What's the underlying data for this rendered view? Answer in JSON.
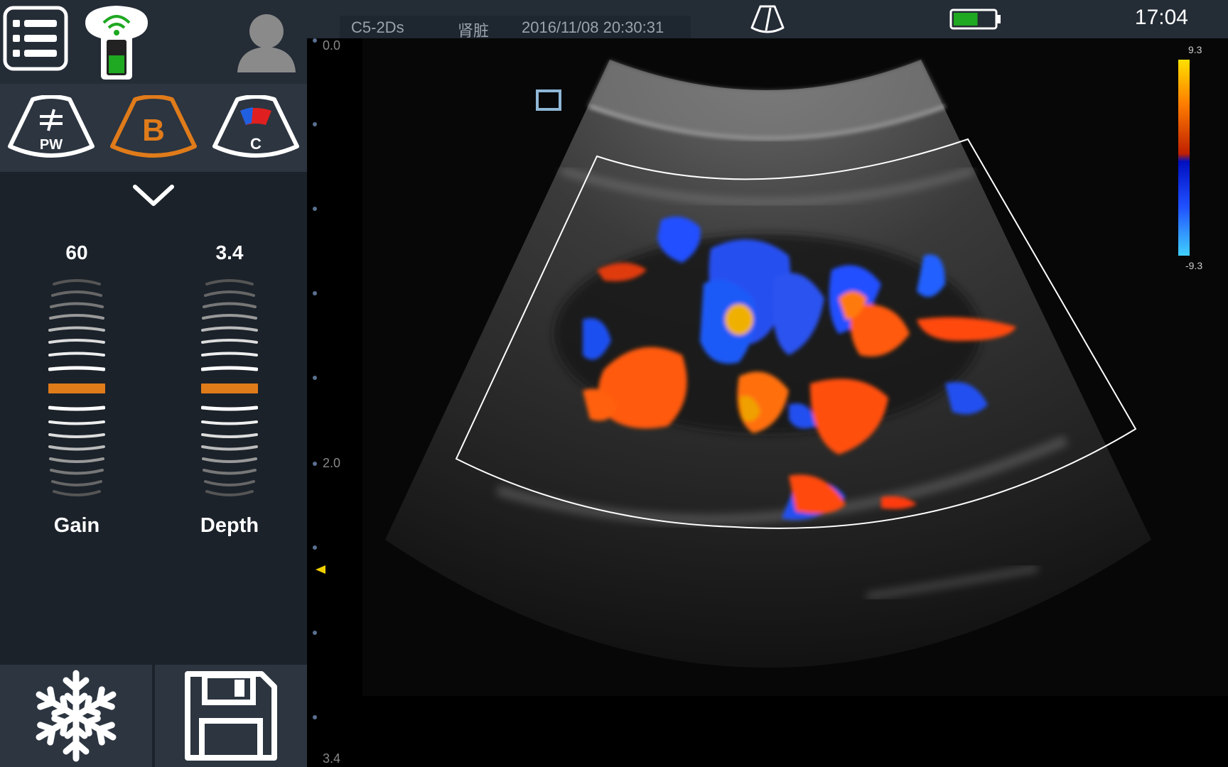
{
  "header": {
    "probe": "C5-2Ds",
    "organ": "肾脏",
    "datetime": "2016/11/08 20:30:31",
    "clock": "17:04"
  },
  "modes": [
    {
      "label": "PW",
      "icon": "pw-mode-icon",
      "active": false
    },
    {
      "label": "B",
      "icon": "b-mode-icon",
      "active": true
    },
    {
      "label": "C",
      "icon": "color-mode-icon",
      "active": false
    }
  ],
  "controls": {
    "gain": {
      "label": "Gain",
      "value": "60"
    },
    "depth": {
      "label": "Depth",
      "value": "3.4"
    }
  },
  "depth_scale": {
    "top": "0.0",
    "mid": "2.0",
    "bottom": "3.4"
  },
  "color_scale": {
    "max": "9.3",
    "min": "-9.3"
  },
  "colors": {
    "accent": "#e07b1a",
    "panel": "#2c3540",
    "battery": "#1fa821"
  },
  "battery_level": 0.6
}
